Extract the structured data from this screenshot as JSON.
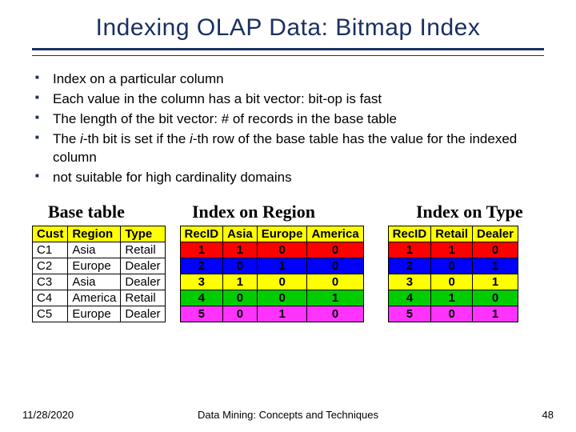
{
  "title": "Indexing OLAP Data: Bitmap Index",
  "bullets": [
    "Index on a particular column",
    "Each value in the column has a bit vector: bit-op is fast",
    "The length of the bit vector: # of records in the base table",
    "",
    "not suitable for high cardinality domains"
  ],
  "bullet4": {
    "a": "The ",
    "b": "i",
    "c": "-th bit is set if the ",
    "d": "i",
    "e": "-th row of the base table has the value for the indexed column"
  },
  "labels": {
    "base": "Base table",
    "region": "Index on Region",
    "type": "Index on Type"
  },
  "base": {
    "headers": [
      "Cust",
      "Region",
      "Type"
    ],
    "rows": [
      [
        "C1",
        "Asia",
        "Retail"
      ],
      [
        "C2",
        "Europe",
        "Dealer"
      ],
      [
        "C3",
        "Asia",
        "Dealer"
      ],
      [
        "C4",
        "America",
        "Retail"
      ],
      [
        "C5",
        "Europe",
        "Dealer"
      ]
    ]
  },
  "region_index": {
    "headers": [
      "RecID",
      "Asia",
      "Europe",
      "America"
    ],
    "rows": [
      {
        "c": "rg",
        "v": [
          "1",
          "1",
          "0",
          "0"
        ]
      },
      {
        "c": "rb",
        "v": [
          "2",
          "0",
          "1",
          "0"
        ]
      },
      {
        "c": "ry",
        "v": [
          "3",
          "1",
          "0",
          "0"
        ]
      },
      {
        "c": "rgn",
        "v": [
          "4",
          "0",
          "0",
          "1"
        ]
      },
      {
        "c": "rmag",
        "v": [
          "5",
          "0",
          "1",
          "0"
        ]
      }
    ]
  },
  "type_index": {
    "headers": [
      "RecID",
      "Retail",
      "Dealer"
    ],
    "rows": [
      {
        "c": "rg",
        "v": [
          "1",
          "1",
          "0"
        ]
      },
      {
        "c": "rb",
        "v": [
          "2",
          "0",
          "1"
        ]
      },
      {
        "c": "ry",
        "v": [
          "3",
          "0",
          "1"
        ]
      },
      {
        "c": "rgn",
        "v": [
          "4",
          "1",
          "0"
        ]
      },
      {
        "c": "rmag",
        "v": [
          "5",
          "0",
          "1"
        ]
      }
    ]
  },
  "footer": {
    "date": "11/28/2020",
    "center": "Data Mining: Concepts and Techniques",
    "page": "48"
  },
  "chart_data": [
    {
      "type": "table",
      "title": "Base table",
      "columns": [
        "Cust",
        "Region",
        "Type"
      ],
      "rows": [
        [
          "C1",
          "Asia",
          "Retail"
        ],
        [
          "C2",
          "Europe",
          "Dealer"
        ],
        [
          "C3",
          "Asia",
          "Dealer"
        ],
        [
          "C4",
          "America",
          "Retail"
        ],
        [
          "C5",
          "Europe",
          "Dealer"
        ]
      ]
    },
    {
      "type": "table",
      "title": "Index on Region",
      "columns": [
        "RecID",
        "Asia",
        "Europe",
        "America"
      ],
      "rows": [
        [
          1,
          1,
          0,
          0
        ],
        [
          2,
          0,
          1,
          0
        ],
        [
          3,
          1,
          0,
          0
        ],
        [
          4,
          0,
          0,
          1
        ],
        [
          5,
          0,
          1,
          0
        ]
      ]
    },
    {
      "type": "table",
      "title": "Index on Type",
      "columns": [
        "RecID",
        "Retail",
        "Dealer"
      ],
      "rows": [
        [
          1,
          1,
          0
        ],
        [
          2,
          0,
          1
        ],
        [
          3,
          0,
          1
        ],
        [
          4,
          1,
          0
        ],
        [
          5,
          0,
          1
        ]
      ]
    }
  ]
}
